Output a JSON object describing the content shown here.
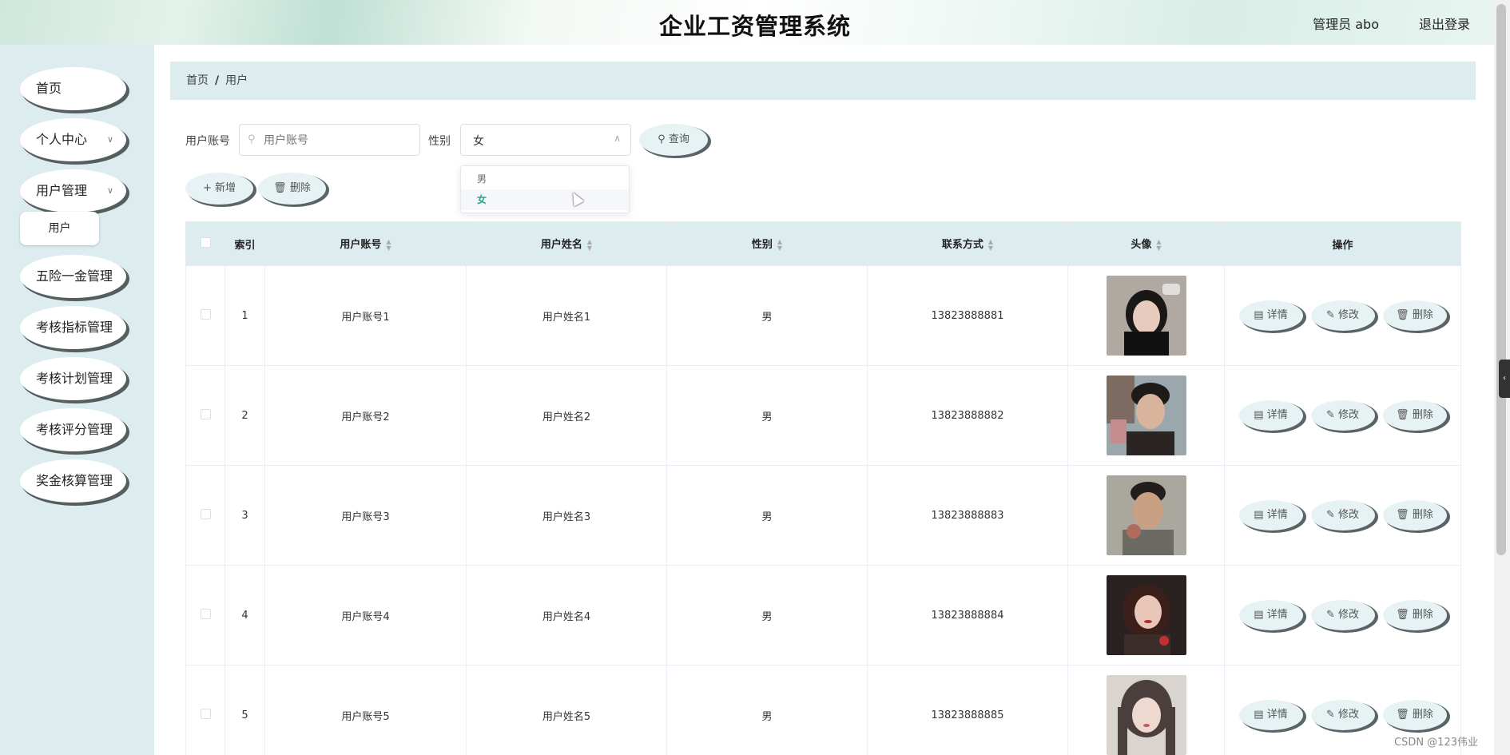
{
  "header": {
    "title": "企业工资管理系统",
    "user": "管理员 abo",
    "logout": "退出登录"
  },
  "sidebar": {
    "items": [
      {
        "label": "首页"
      },
      {
        "label": "个人中心"
      },
      {
        "label": "用户管理"
      },
      {
        "label": "五险一金管理"
      },
      {
        "label": "考核指标管理"
      },
      {
        "label": "考核计划管理"
      },
      {
        "label": "考核评分管理"
      },
      {
        "label": "奖金核算管理"
      }
    ],
    "sub_item": "用户"
  },
  "breadcrumb": {
    "home": "首页",
    "sep": "/",
    "current": "用户"
  },
  "search": {
    "account_label": "用户账号",
    "account_placeholder": "用户账号",
    "gender_label": "性别",
    "gender_value": "女",
    "query_button": "查询",
    "options": [
      "男",
      "女"
    ]
  },
  "toolbar": {
    "add": "新增",
    "delete": "删除"
  },
  "table": {
    "headers": [
      "索引",
      "用户账号",
      "用户姓名",
      "性别",
      "联系方式",
      "头像",
      "操作"
    ],
    "rows": [
      {
        "idx": "1",
        "account": "用户账号1",
        "name": "用户姓名1",
        "gender": "男",
        "phone": "13823888881"
      },
      {
        "idx": "2",
        "account": "用户账号2",
        "name": "用户姓名2",
        "gender": "男",
        "phone": "13823888882"
      },
      {
        "idx": "3",
        "account": "用户账号3",
        "name": "用户姓名3",
        "gender": "男",
        "phone": "13823888883"
      },
      {
        "idx": "4",
        "account": "用户账号4",
        "name": "用户姓名4",
        "gender": "男",
        "phone": "13823888884"
      },
      {
        "idx": "5",
        "account": "用户账号5",
        "name": "用户姓名5",
        "gender": "男",
        "phone": "13823888885"
      }
    ],
    "actions": {
      "detail": "详情",
      "edit": "修改",
      "delete": "删除"
    }
  },
  "watermark": "CSDN @123伟业",
  "colors": {
    "accent": "#2fa48a",
    "sidebar_bg": "#dcecef",
    "button_bg": "#e7f2f4"
  }
}
